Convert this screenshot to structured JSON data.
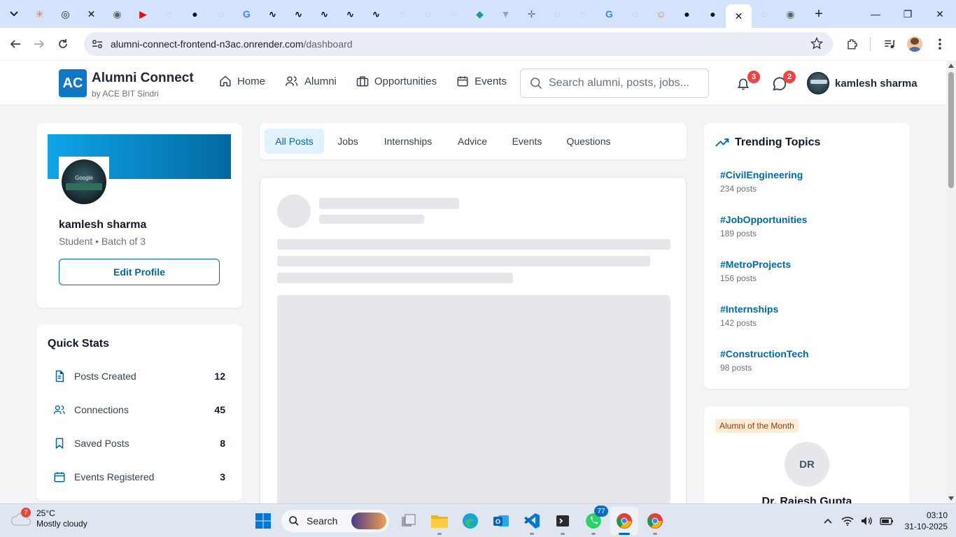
{
  "browser": {
    "url_host": "alumni-connect-frontend-n3ac.onrender.com",
    "url_path": "/dashboard",
    "tab_count": 30,
    "tab_favicons": [
      "claude-icon",
      "openai-icon",
      "x-icon",
      "chrome-icon",
      "youtube-icon",
      "globe-icon",
      "dark-circle-icon",
      "globe-icon",
      "google-icon",
      "wavy-icon",
      "wavy-icon",
      "wavy-icon",
      "wavy-icon",
      "wavy-icon",
      "globe-icon",
      "globe-icon",
      "globe-icon",
      "diamond-icon",
      "vee-icon",
      "crosshair-icon",
      "globe-icon",
      "globe-icon",
      "google-icon",
      "globe-icon",
      "profile-icon",
      "github-icon",
      "github-icon",
      "active-close",
      "globe-icon",
      "chrome-icon"
    ]
  },
  "app": {
    "logo_text": "AC",
    "title": "Alumni Connect",
    "subtitle": "by ACE BIT Sindri",
    "nav": {
      "home": "Home",
      "alumni": "Alumni",
      "opportunities": "Opportunities",
      "events": "Events"
    },
    "search_placeholder": "Search alumni, posts, jobs...",
    "notifications_count": "3",
    "messages_count": "2",
    "user_name": "kamlesh sharma"
  },
  "profile": {
    "photo_label": "Google",
    "name": "kamlesh sharma",
    "role": "Student • Batch of 3",
    "edit_label": "Edit Profile"
  },
  "quick_stats": {
    "title": "Quick Stats",
    "rows": [
      {
        "label": "Posts Created",
        "value": "12",
        "icon": "document-icon"
      },
      {
        "label": "Connections",
        "value": "45",
        "icon": "users-icon"
      },
      {
        "label": "Saved Posts",
        "value": "8",
        "icon": "bookmark-icon"
      },
      {
        "label": "Events Registered",
        "value": "3",
        "icon": "calendar-icon"
      }
    ]
  },
  "feed": {
    "tabs": [
      "All Posts",
      "Jobs",
      "Internships",
      "Advice",
      "Events",
      "Questions"
    ],
    "active_tab": "All Posts",
    "state": "loading"
  },
  "trending": {
    "title": "Trending Topics",
    "items": [
      {
        "tag": "#CivilEngineering",
        "count": "234 posts"
      },
      {
        "tag": "#JobOpportunities",
        "count": "189 posts"
      },
      {
        "tag": "#MetroProjects",
        "count": "156 posts"
      },
      {
        "tag": "#Internships",
        "count": "142 posts"
      },
      {
        "tag": "#ConstructionTech",
        "count": "98 posts"
      }
    ]
  },
  "alumni_of_month": {
    "badge": "Alumni of the Month",
    "initials": "DR",
    "name": "Dr. Rajesh Gupta"
  },
  "taskbar": {
    "weather_badge": "7",
    "temperature": "25°C",
    "condition": "Mostly cloudy",
    "search_label": "Search",
    "whatsapp_badge": "77",
    "time": "03:10",
    "date": "31-10-2025"
  },
  "colors": {
    "brand": "#1077c4",
    "link": "#0369a1",
    "badge": "#ef4444",
    "active_tab_bg": "#e0f2fe"
  }
}
